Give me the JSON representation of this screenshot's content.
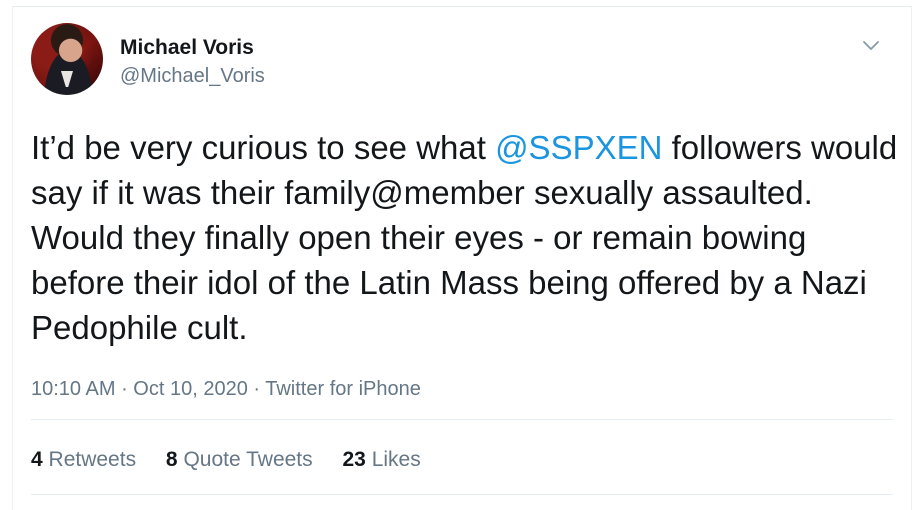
{
  "author": {
    "name": "Michael Voris",
    "handle": "@Michael_Voris"
  },
  "tweet": {
    "text_before_mention": "It’d be very curious to see what ",
    "mention": "@SSPXEN",
    "text_after_mention": " followers would say if it was their family@member sexually assaulted. Would they finally open their eyes - or remain bowing before their idol of the Latin Mass being offered by a Nazi Pedophile cult."
  },
  "meta": {
    "time": "10:10 AM",
    "separator": " · ",
    "date": "Oct 10, 2020",
    "source": "Twitter for iPhone"
  },
  "stats": {
    "retweets_count": "4",
    "retweets_label": "Retweets",
    "quotes_count": "8",
    "quotes_label": "Quote Tweets",
    "likes_count": "23",
    "likes_label": "Likes"
  },
  "icons": {
    "menu": "chevron-down-icon",
    "avatar": "profile-photo"
  },
  "colors": {
    "mention": "#1b95e0",
    "secondary_text": "#657786",
    "primary_text": "#14171a",
    "divider": "#e6ecf0"
  }
}
